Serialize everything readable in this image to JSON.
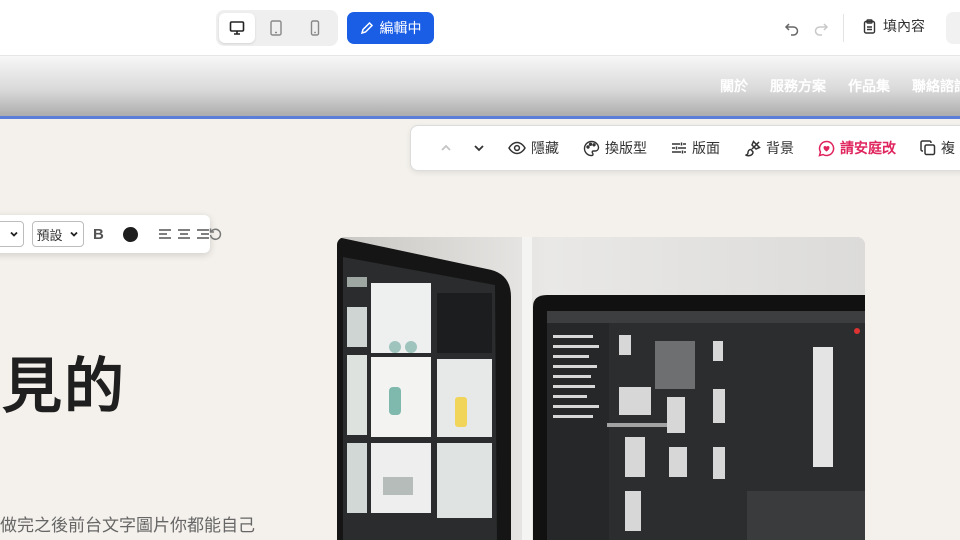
{
  "topbar": {
    "devices": [
      {
        "icon": "desktop-icon",
        "active": true
      },
      {
        "icon": "tablet-icon",
        "active": false
      },
      {
        "icon": "mobile-icon",
        "active": false
      }
    ],
    "edit_label": "編輯中",
    "fill_label": "填內容",
    "accent": "#1a5ee6"
  },
  "site_nav": {
    "items": [
      "關於",
      "服務方案",
      "作品集",
      "聯絡諮詢"
    ]
  },
  "section_toolbar": {
    "hide": "隱藏",
    "layout_type": "換版型",
    "layout": "版面",
    "background": "背景",
    "request": "請安庭改",
    "duplicate": "複",
    "highlight_color": "#e0245e"
  },
  "text_toolbar": {
    "size_value": "",
    "preset_value": "預設",
    "bold_label": "B",
    "text_color": "#1e1e1e"
  },
  "hero": {
    "title": "見的",
    "subtitle": "做完之後前台文字圖片你都能自己"
  }
}
